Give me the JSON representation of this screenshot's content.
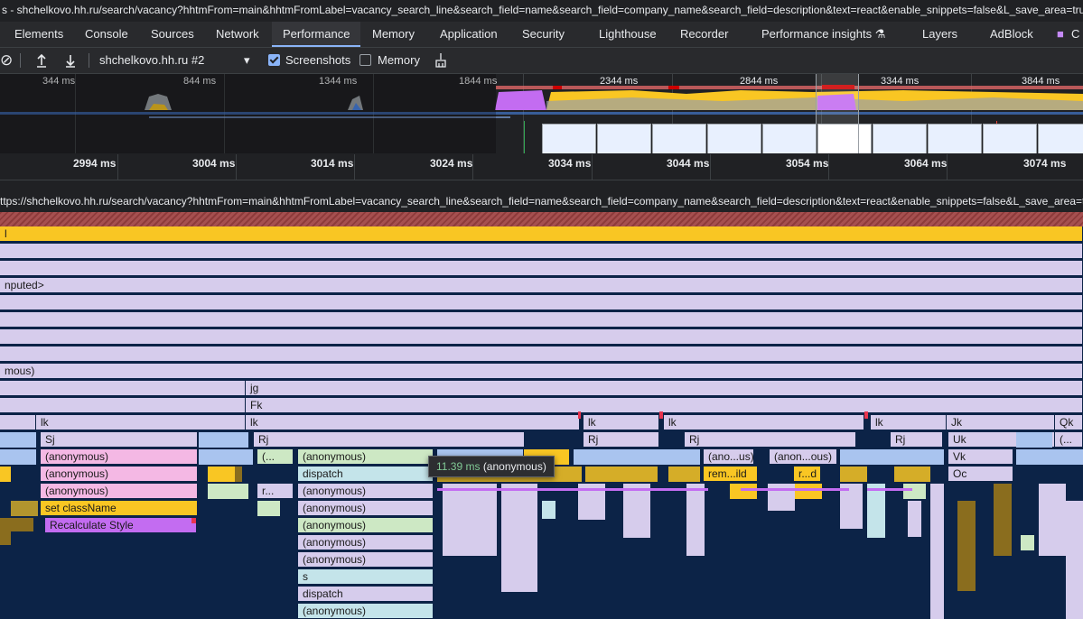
{
  "window": {
    "title": "s - shchelkovo.hh.ru/search/vacancy?hhtmFrom=main&hhtmFromLabel=vacancy_search_line&search_field=name&search_field=company_name&search_field=description&text=react&enable_snippets=false&L_save_area=true"
  },
  "tabs": [
    "Elements",
    "Console",
    "Sources",
    "Network",
    "Performance",
    "Memory",
    "Application",
    "Security",
    "Lighthouse",
    "Recorder",
    "Performance insights",
    "Layers",
    "AdBlock"
  ],
  "active_tab": "Performance",
  "toolbar": {
    "profile_select": "shchelkovo.hh.ru #2",
    "screenshots_label": "Screenshots",
    "screenshots_checked": true,
    "memory_label": "Memory",
    "memory_checked": false
  },
  "overview": {
    "ticks": [
      "344 ms",
      "844 ms",
      "1344 ms",
      "1844 ms",
      "2344 ms",
      "2844 ms",
      "3344 ms",
      "3844 ms"
    ]
  },
  "ruler": {
    "ticks": [
      "2994 ms",
      "3004 ms",
      "3014 ms",
      "3024 ms",
      "3034 ms",
      "3044 ms",
      "3054 ms",
      "3064 ms",
      "3074 ms"
    ]
  },
  "url_track": "ttps://shchelkovo.hh.ru/search/vacancy?hhtmFrom=main&hhtmFromLabel=vacancy_search_line&search_field=name&search_field=company_name&search_field=description&text=react&enable_snippets=false&L_save_area=true",
  "flame": {
    "r1": "l",
    "r4": "nputed>",
    "r9": "mous)",
    "jg": "jg",
    "fk": "Fk",
    "lk1": "lk",
    "lk2": "lk",
    "lk3": "lk",
    "lk4": "lk",
    "lk5": "lk",
    "jk": "Jk",
    "qk": "Qk",
    "sj": "Sj",
    "rj1": "Rj",
    "rj2": "Rj",
    "rj3": "Rj",
    "rj4": "Rj",
    "uk": "Uk",
    "paren1": "(...",
    "anon_a1": "(anonymous)",
    "anon_a2": "(anonymous)",
    "anon_a3": "(anonymous)",
    "set_classname": "set className",
    "recalc": "Recalculate Style",
    "paren_small": "(...",
    "r_small": "r...",
    "anon_b1": "(anonymous)",
    "dispatch1": "dispatch",
    "anon_b2": "(anonymous)",
    "anon_b3": "(anonymous)",
    "anon_b4": "(anonymous)",
    "anon_b5": "(anonymous)",
    "anon_b6": "(anonymous)",
    "s": "s",
    "dispatch2": "dispatch",
    "anon_b7": "(anonymous)",
    "anous1": "(ano...us)",
    "anous2": "(anon...ous)",
    "remild": "rem...ild",
    "rd": "r...d",
    "vk": "Vk",
    "oc": "Oc",
    "paren2": "(..."
  },
  "tooltip": {
    "duration": "11.39 ms",
    "name": "(anonymous)"
  },
  "colors": {
    "accent": "#8ab4f8",
    "flame_bg": "#0c2347",
    "yellow": "#f9c623",
    "lavender": "#d6ccec"
  }
}
